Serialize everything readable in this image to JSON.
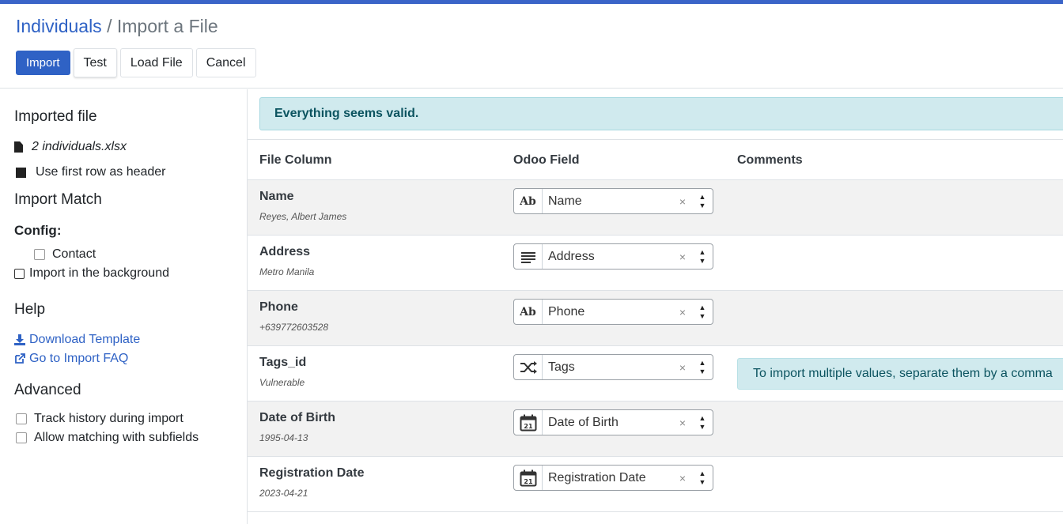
{
  "breadcrumb": {
    "parent": "Individuals",
    "separator": "/",
    "current": "Import a File"
  },
  "actions": {
    "import": "Import",
    "test": "Test",
    "load_file": "Load File",
    "cancel": "Cancel"
  },
  "sidebar": {
    "imported_file_heading": "Imported file",
    "file_name": "2 individuals.xlsx",
    "first_row_header": "Use first row as header",
    "import_match_heading": "Import Match",
    "config_label": "Config:",
    "contact": "Contact",
    "background": "Import in the background",
    "help_heading": "Help",
    "download_template": "Download Template",
    "import_faq": "Go to Import FAQ",
    "advanced_heading": "Advanced",
    "track_history": "Track history during import",
    "allow_subfields": "Allow matching with subfields"
  },
  "alert": "Everything seems valid.",
  "table": {
    "headers": {
      "file_column": "File Column",
      "odoo_field": "Odoo Field",
      "comments": "Comments"
    },
    "rows": [
      {
        "name": "Name",
        "sample": "Reyes, Albert James",
        "field": "Name",
        "icon": "text-icon",
        "comment": ""
      },
      {
        "name": "Address",
        "sample": "Metro Manila",
        "field": "Address",
        "icon": "textarea-icon",
        "comment": ""
      },
      {
        "name": "Phone",
        "sample": "+639772603528",
        "field": "Phone",
        "icon": "text-icon",
        "comment": ""
      },
      {
        "name": "Tags_id",
        "sample": "Vulnerable",
        "field": "Tags",
        "icon": "many2many-icon",
        "comment": "To import multiple values, separate them by a comma"
      },
      {
        "name": "Date of Birth",
        "sample": "1995-04-13",
        "field": "Date of Birth",
        "icon": "calendar-icon",
        "comment": ""
      },
      {
        "name": "Registration Date",
        "sample": "2023-04-21",
        "field": "Registration Date",
        "icon": "calendar-icon",
        "comment": ""
      }
    ]
  },
  "icon_text": {
    "text": "Ab",
    "calendar": "21",
    "clear": "×",
    "up": "▲",
    "down": "▼"
  },
  "colors": {
    "accent": "#2f62c5",
    "alert_bg": "#d0eaee",
    "alert_text": "#0c5460"
  }
}
